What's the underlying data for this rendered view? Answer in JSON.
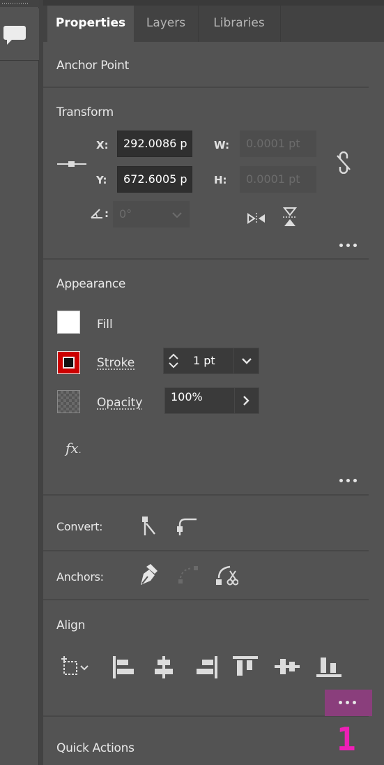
{
  "tabs": [
    {
      "label": "Properties",
      "active": true
    },
    {
      "label": "Layers",
      "active": false
    },
    {
      "label": "Libraries",
      "active": false
    }
  ],
  "anchor_point": {
    "title": "Anchor Point"
  },
  "transform": {
    "title": "Transform",
    "x_label": "X:",
    "x_value": "292.0086 p",
    "y_label": "Y:",
    "y_value": "672.6005 p",
    "w_label": "W:",
    "w_value": "0.0001 pt",
    "h_label": "H:",
    "h_value": "0.0001 pt",
    "angle_value": "0°"
  },
  "appearance": {
    "title": "Appearance",
    "fill_label": "Fill",
    "fill_color": "#ffffff",
    "stroke_label": "Stroke",
    "stroke_color": "#cc0000",
    "stroke_weight": "1 pt",
    "opacity_label": "Opacity",
    "opacity_value": "100%",
    "fx_label": "fx"
  },
  "convert": {
    "label": "Convert:"
  },
  "anchors": {
    "label": "Anchors:"
  },
  "align": {
    "title": "Align"
  },
  "quick_actions": {
    "title": "Quick Actions"
  },
  "callout": {
    "label": "1",
    "color": "#ee1fb6"
  },
  "highlight_color": "#8a3e7c"
}
